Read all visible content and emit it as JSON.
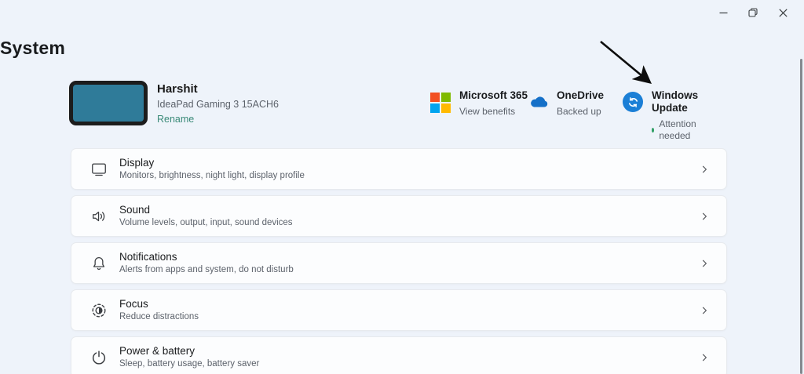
{
  "window": {
    "minimize_label": "minimize",
    "restore_label": "restore",
    "close_label": "close"
  },
  "page": {
    "title": "System"
  },
  "profile": {
    "name": "Harshit",
    "device_model": "IdeaPad Gaming 3 15ACH6",
    "rename_label": "Rename"
  },
  "status_tiles": [
    {
      "title": "Microsoft 365",
      "subtitle": "View benefits",
      "icon": "microsoft-logo-icon"
    },
    {
      "title": "OneDrive",
      "subtitle": "Backed up",
      "icon": "onedrive-cloud-icon"
    },
    {
      "title": "Windows Update",
      "subtitle": "Attention needed",
      "icon": "windows-update-icon",
      "has_status_dot": true
    }
  ],
  "settings_cards": [
    {
      "title": "Display",
      "subtitle": "Monitors, brightness, night light, display profile",
      "icon": "display-icon"
    },
    {
      "title": "Sound",
      "subtitle": "Volume levels, output, input, sound devices",
      "icon": "sound-icon"
    },
    {
      "title": "Notifications",
      "subtitle": "Alerts from apps and system, do not disturb",
      "icon": "notifications-icon"
    },
    {
      "title": "Focus",
      "subtitle": "Reduce distractions",
      "icon": "focus-icon"
    },
    {
      "title": "Power & battery",
      "subtitle": "Sleep, battery usage, battery saver",
      "icon": "power-icon"
    }
  ],
  "annotation": {
    "type": "arrow",
    "points_to": "Windows Update"
  },
  "colors": {
    "page_background": "#eef3fa",
    "card_background": "#fcfdfe",
    "device_thumbnail_fill": "#2f7b99",
    "rename_link": "#3a8a78",
    "status_dot_green": "#2e9e64",
    "windows_update_blue": "#1b7fd6",
    "onedrive_blue": "#1570c8",
    "ms_logo_red": "#f25022",
    "ms_logo_green": "#7fba00",
    "ms_logo_blue": "#00a4ef",
    "ms_logo_yellow": "#ffb900"
  }
}
